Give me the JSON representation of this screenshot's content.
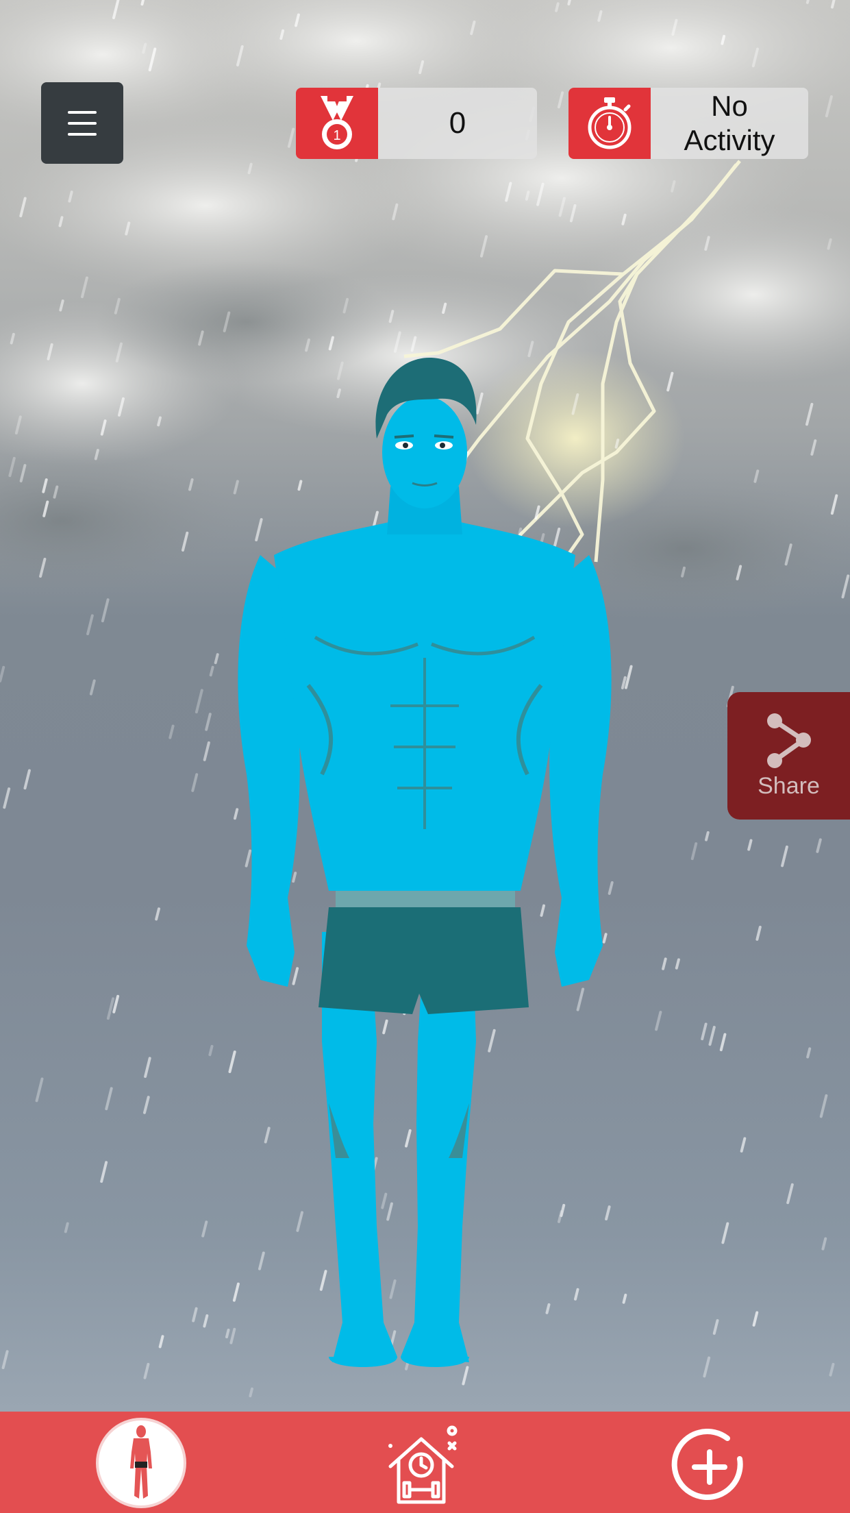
{
  "header": {
    "menu_icon": "hamburger-menu-icon",
    "score": {
      "icon": "medal-icon",
      "value": "0"
    },
    "activity": {
      "icon": "stopwatch-icon",
      "line1": "No",
      "line2": "Activity"
    }
  },
  "share": {
    "icon": "share-icon",
    "label": "Share"
  },
  "scene": {
    "weather": "thunderstorm-rain",
    "avatar_skin_color": "#00b9e8",
    "shorts_color": "#1b6e76"
  },
  "bottom_nav": {
    "items": [
      {
        "icon": "body-avatar-icon",
        "selected": true
      },
      {
        "icon": "home-gym-icon",
        "selected": false
      },
      {
        "icon": "add-circle-icon",
        "selected": false
      }
    ]
  },
  "colors": {
    "accent": "#e1343a",
    "nav_bg": "#e34e50",
    "menu_bg": "#363c40",
    "share_bg": "#7d1f22"
  }
}
